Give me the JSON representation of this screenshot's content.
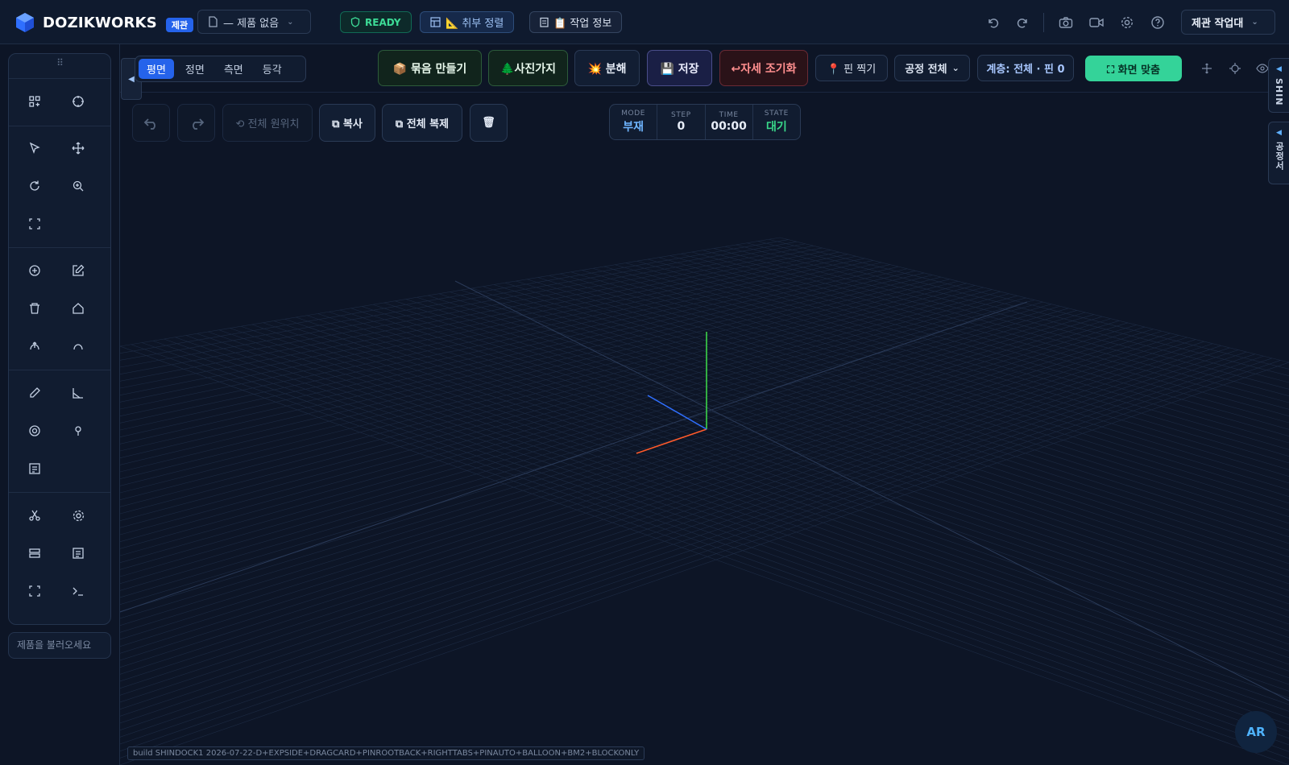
{
  "app": {
    "brand": "DOZIKWORKS",
    "role_badge": "제관"
  },
  "topbar": {
    "product_select": "— 제품 없음",
    "status": "READY",
    "align_button": "📐 취부 정렬",
    "info_button": "📋 작업 정보",
    "station_select": "제관 작업대",
    "icons": [
      "undo-icon",
      "redo-icon",
      "camera-icon",
      "video-icon",
      "gear-icon",
      "help-icon"
    ]
  },
  "view_tabs": [
    "평면",
    "정면",
    "측면",
    "등각"
  ],
  "view_tab_active": "평면",
  "actions": {
    "bundle": "📦 묶음 만들기",
    "branch": "🌲사진가지",
    "explode": "💥 분해",
    "save": "💾 저장",
    "reset_pose": "↩자세 조기화",
    "pin": "📍 핀 찍기",
    "process_select": "공정 전체",
    "layer_info": "계층: 전체 · 핀 0",
    "fit_screen": "⛶ 화면 맞춤"
  },
  "edit_toolbar": {
    "reset_all_position": "⟲ 전체 원위치",
    "copy": "⧉ 복사",
    "duplicate_all": "⧉ 전체 복제",
    "trash_icon": "🗑"
  },
  "hud": {
    "mode_label": "MODE",
    "mode_value": "부재",
    "step_label": "STEP",
    "step_value": "0",
    "time_label": "TIME",
    "time_value": "00:00",
    "state_label": "STATE",
    "state_value": "대기"
  },
  "side_tabs": {
    "top": "SHIN",
    "bottom": "공정서"
  },
  "left_rail": {
    "handle": "⠿",
    "search_placeholder": "제품을 불러오세요",
    "tools": [
      "add-grid-icon",
      "crosshair-icon",
      "pointer-icon",
      "move-icon",
      "rotate-icon",
      "zoom-icon",
      "fullscreen-icon",
      "add-circle-icon",
      "edit-icon",
      "trash-icon",
      "home-icon",
      "arc-up-icon",
      "arc-icon",
      "pencil-icon",
      "angle-icon",
      "target-icon",
      "pin-icon",
      "note-icon",
      "scissors-icon",
      "settings-icon",
      "database-icon",
      "list-icon",
      "expand-icon",
      "terminal-icon"
    ]
  },
  "viewport": {
    "build_tag": "build SHINDOCK1 2026-07-22-D+EXPSIDE+DRAGCARD+PINROOTBACK+RIGHTTABS+PINAUTO+BALLOON+BM2+BLOCKONLY",
    "ar_button": "AR",
    "axis_colors": {
      "x": "#ff5a2a",
      "y": "#3ee04a",
      "z": "#2f6fff"
    },
    "grid_color": "#1d2b44"
  },
  "colors": {
    "accent_blue": "#2563eb",
    "accent_green": "#34d399",
    "danger": "#ff8f8f",
    "ready": "#3ddc97"
  }
}
